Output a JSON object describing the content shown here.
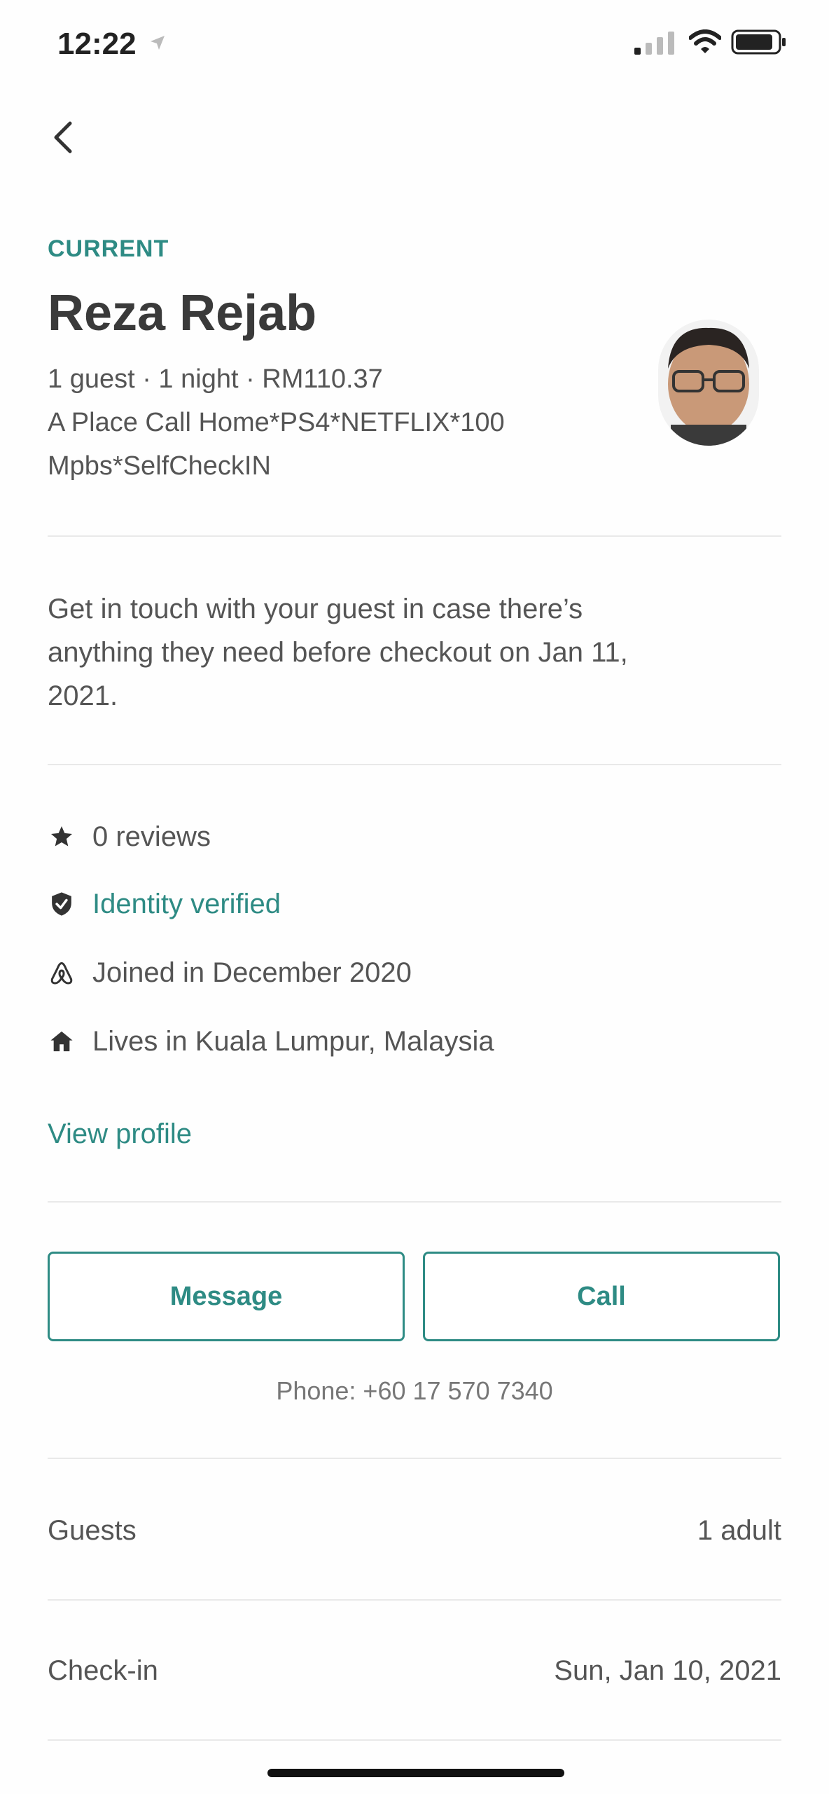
{
  "status_bar": {
    "time": "12:22"
  },
  "colors": {
    "accent": "#2e8b84",
    "text": "#444444",
    "divider": "#e9e9e9"
  },
  "header": {
    "back_icon": "chevron-left-icon"
  },
  "reservation": {
    "status": "CURRENT",
    "guest_name": "Reza Rejab",
    "summary": "1 guest · 1 night · RM110.37",
    "listing_line1": "A Place Call Home*PS4*NETFLIX*100",
    "listing_line2": "Mpbs*SelfCheckIN"
  },
  "message": {
    "line1": "Get in touch with your guest in case there’s",
    "line2": "anything they need before checkout on Jan 11,",
    "line3": "2021."
  },
  "guest_info": [
    {
      "icon": "star-icon",
      "text": "0 reviews"
    },
    {
      "icon": "verified-shield-icon",
      "text": "Identity verified"
    },
    {
      "icon": "airbnb-logo-icon",
      "text": "Joined in December 2020"
    },
    {
      "icon": "home-icon",
      "text": "Lives in Kuala Lumpur, Malaysia"
    }
  ],
  "view_profile_label": "View profile",
  "actions": {
    "message_label": "Message",
    "call_label": "Call"
  },
  "phone_text": "Phone: +60 17 570 7340",
  "details": [
    {
      "label": "Guests",
      "value": "1 adult"
    },
    {
      "label": "Check-in",
      "value": "Sun, Jan 10, 2021"
    }
  ]
}
